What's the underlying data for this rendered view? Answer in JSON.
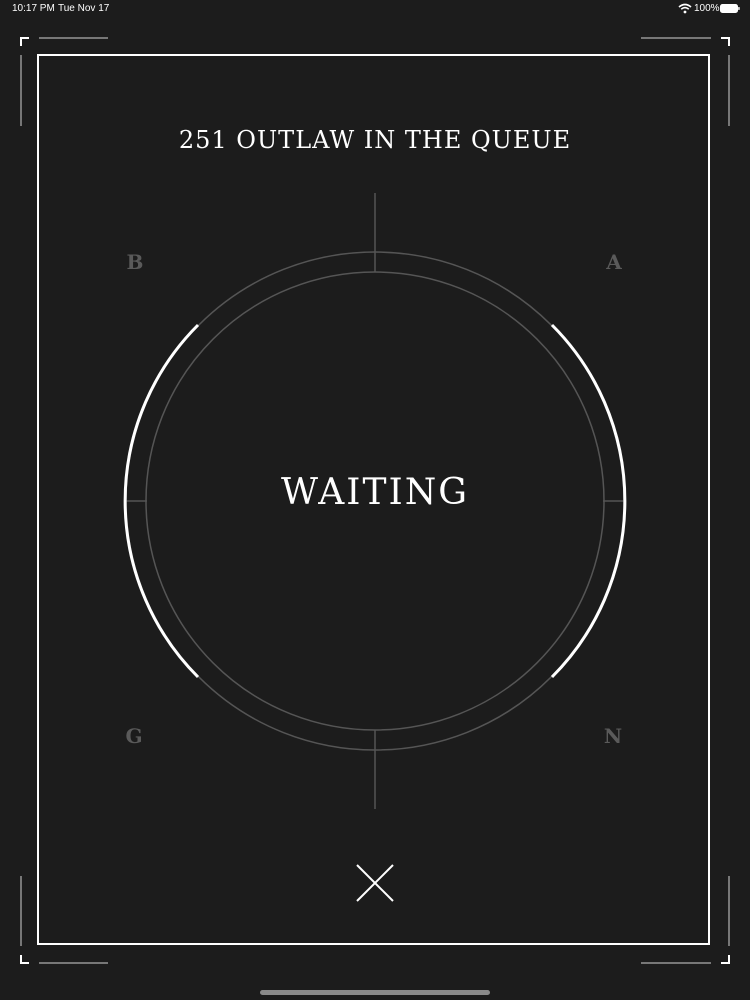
{
  "status_bar": {
    "time": "10:17 PM",
    "date": "Tue Nov 17",
    "battery": "100%",
    "icons": [
      "wifi-icon",
      "battery-icon"
    ]
  },
  "queue": {
    "title": "251 OUTLAW IN THE QUEUE"
  },
  "corners": {
    "top_left": "B",
    "top_right": "A",
    "bottom_left": "G",
    "bottom_right": "N"
  },
  "status": {
    "label": "WAITING"
  },
  "controls": {
    "close_icon": "close-icon"
  },
  "colors": {
    "background": "#1c1c1c",
    "foreground": "#ffffff",
    "muted": "#5a5a5a",
    "ring": "#555555"
  }
}
